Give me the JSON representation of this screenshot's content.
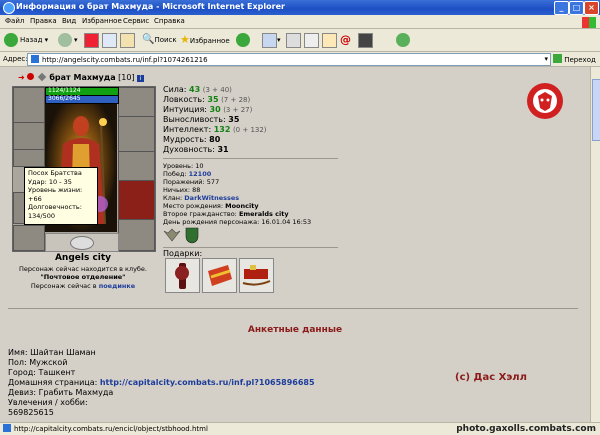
{
  "window": {
    "title": "Информация о брат Махмуда - Microsoft Internet Explorer"
  },
  "menu": [
    "Файл",
    "Правка",
    "Вид",
    "Избранное",
    "Сервис",
    "Справка"
  ],
  "toolbar": {
    "back": "Назад",
    "search": "Поиск",
    "favorites": "Избранное"
  },
  "address": {
    "label": "Адрес:",
    "url": "http://angelscity.combats.ru/inf.pl?1074261216",
    "go": "Переход"
  },
  "character": {
    "name": "брат Махмуда",
    "level": "[10]",
    "hp": "1124/1124",
    "mana": "3066/2645",
    "city_label": "Angels city",
    "location_text": "Персонаж сейчас находится в клубе.",
    "location_room": "\"Почтовое отделение\"",
    "fight_prefix": "Персонаж сейчас в",
    "fight_link": "поединке"
  },
  "tooltip": {
    "lines": [
      "Посох Братства",
      "Удар: 10 - 35",
      "Уровень жизни: +66",
      "Долговечность: 134/500"
    ]
  },
  "stats": [
    {
      "label": "Сила:",
      "value": "43",
      "bonus": "(3 + 40)"
    },
    {
      "label": "Ловкость:",
      "value": "35",
      "bonus": "(7 + 28)"
    },
    {
      "label": "Интуиция:",
      "value": "30",
      "bonus": "(3 + 27)"
    },
    {
      "label": "Выносливость:",
      "value": "35",
      "bonus": ""
    },
    {
      "label": "Интеллект:",
      "value": "132",
      "bonus": "(0 + 132)"
    },
    {
      "label": "Мудрость:",
      "value": "80",
      "bonus": ""
    },
    {
      "label": "Духовность:",
      "value": "31",
      "bonus": ""
    }
  ],
  "info": [
    {
      "label": "Уровень:",
      "value": "10",
      "style": "plain"
    },
    {
      "label": "Побед:",
      "value": "12100",
      "style": "blue"
    },
    {
      "label": "Поражений:",
      "value": "577",
      "style": "plain"
    },
    {
      "label": "Ничьих:",
      "value": "88",
      "style": "plain"
    },
    {
      "label": "Клан:",
      "value": "DarkWitnesses",
      "style": "blue"
    },
    {
      "label": "Место рождения:",
      "value": "Mooncity",
      "style": "bold"
    },
    {
      "label": "Второе гражданство:",
      "value": "Emeralds city",
      "style": "bold"
    },
    {
      "label": "День рождения персонажа:",
      "value": "16.01.04 16:53",
      "style": "plain"
    }
  ],
  "gifts_label": "Подарки:",
  "profile": {
    "heading": "Анкетные данные",
    "fields": [
      {
        "label": "Имя:",
        "value": "Шайтан Шаман"
      },
      {
        "label": "Пол:",
        "value": "Мужской"
      },
      {
        "label": "Город:",
        "value": "Ташкент"
      },
      {
        "label": "Домашняя страница:",
        "value": "http://capitalcity.combats.ru/inf.pl?1065896685"
      },
      {
        "label": "Девиз:",
        "value": "Грабить Махмуда"
      },
      {
        "label": "Увлечения / хобби:",
        "value": ""
      },
      {
        "label": "",
        "value": "569825615"
      }
    ],
    "signature": "(c) Дас Хэлл"
  },
  "status": {
    "url": "http://capitalcity.combats.ru/encicl/object/stbhood.html"
  },
  "watermark": "photo.gaxolls.combats.com",
  "colors": {
    "accent": "#1d3d9b",
    "stat_green": "#128012",
    "profile_heading": "#8b1a1a"
  }
}
